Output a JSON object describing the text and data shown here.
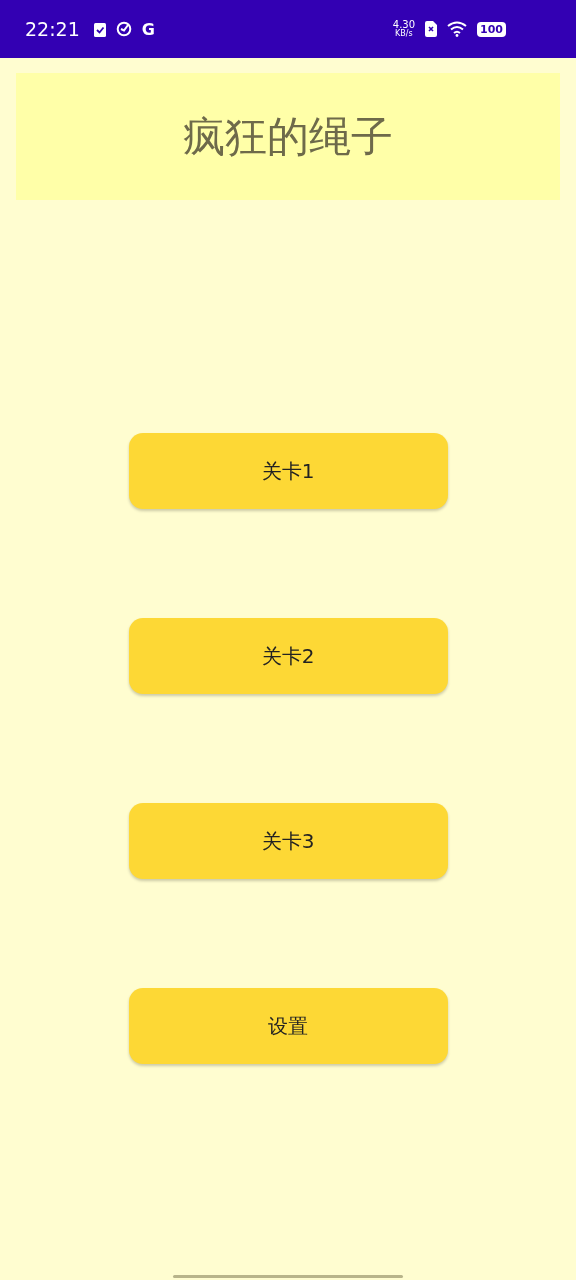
{
  "status_bar": {
    "time": "22:21",
    "network_letter": "G",
    "speed_value": "4.30",
    "speed_unit": "KB/s",
    "battery": "100"
  },
  "header": {
    "title": "疯狂的绳子"
  },
  "buttons": [
    {
      "label": "关卡1"
    },
    {
      "label": "关卡2"
    },
    {
      "label": "关卡3"
    },
    {
      "label": "设置"
    }
  ]
}
